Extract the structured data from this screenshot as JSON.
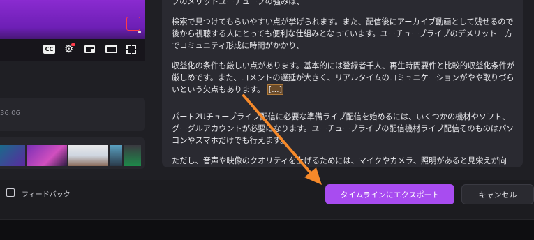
{
  "player": {
    "cc_label": "CC",
    "icons": [
      "closed-captions-icon",
      "settings-gear-icon",
      "miniplayer-icon",
      "theater-mode-icon",
      "fullscreen-icon"
    ]
  },
  "timeline": {
    "time_partial": "36:06"
  },
  "feedback": {
    "label": "フィードバック"
  },
  "text_panel": {
    "paragraphs": [
      "プのメリットユーチューブの強みは、",
      "検索で見つけてもらいやすい点が挙げられます。また、配信後にアーカイブ動画として残せるので後から視聴する人にとっても便利な仕組みとなっています。ユーチューブライブのデメリット一方でコミュニティ形成に時間がかかり、",
      "収益化の条件も厳しい点があります。基本的には登録者千人、再生時間要件と比較的収益化条件が厳しめです。また、コメントの遅延が大きく、リアルタイムのコミュニケーションがやや取りづらいという欠点もあります。",
      "パート2Uチューブライブ配信に必要な準備ライブ配信を始めるには、いくつかの機材やソフト、グーグルアカウントが必要になります。ユーチューブライブの配信機材ライブ配信そのものはパソコンやスマホだけでも行えます。",
      "ただし、音声や映像のクオリティを上げるためには、マイクやカメラ、照明があると見栄えが向"
    ],
    "ellipsis": "[...]"
  },
  "actions": {
    "export_label": "タイムラインにエクスポート",
    "cancel_label": "キャンセル"
  },
  "colors": {
    "accent": "#a84cf0",
    "arrow": "#f5892a",
    "background": "#1c1c20",
    "card": "#2a2a31"
  }
}
